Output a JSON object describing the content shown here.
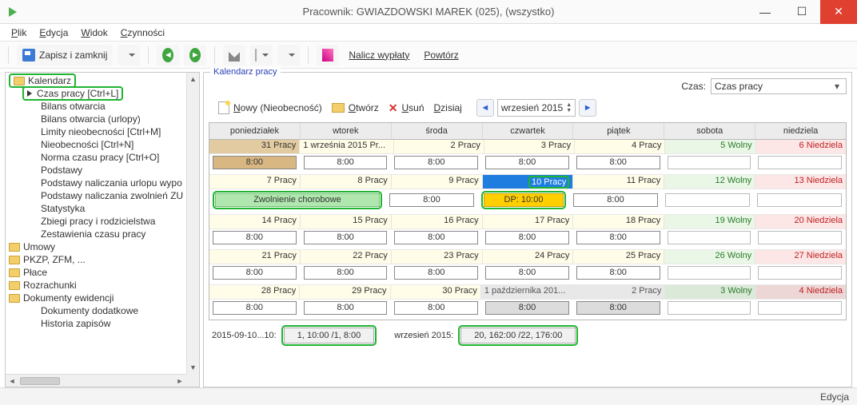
{
  "window": {
    "title": "Pracownik: GWIAZDOWSKI MAREK (025), (wszystko)"
  },
  "menubar": {
    "plik": "Plik",
    "edycja": "Edycja",
    "widok": "Widok",
    "czynnosci": "Czynności"
  },
  "toolbar": {
    "save_close": "Zapisz i zamknij",
    "nalicz": "Nalicz wypłaty",
    "powtorz": "Powtórz"
  },
  "tree": {
    "kalendarz": "Kalendarz",
    "czas_pracy": "Czas pracy [Ctrl+L]",
    "bilans_otwarcia": "Bilans otwarcia",
    "bilans_otwarcia_urlopy": "Bilans otwarcia (urlopy)",
    "limity": "Limity nieobecności [Ctrl+M]",
    "nieobecnosci": "Nieobecności [Ctrl+N]",
    "norma": "Norma czasu pracy [Ctrl+O]",
    "podstawy": "Podstawy",
    "podst_urlop": "Podstawy naliczania urlopu wypo",
    "podst_zwol": "Podstawy naliczania zwolnień ZU",
    "statystyka": "Statystyka",
    "zbiegi": "Zbiegi pracy i rodzicielstwa",
    "zestawienia": "Zestawienia czasu pracy",
    "umowy": "Umowy",
    "pkzp": "PKZP, ZFM, ...",
    "place": "Płace",
    "rozrachunki": "Rozrachunki",
    "dok_ewid": "Dokumenty ewidencji",
    "dok_dodat": "Dokumenty dodatkowe",
    "historia": "Historia zapisów"
  },
  "panel": {
    "fieldset_title": "Kalendarz pracy",
    "czas_label": "Czas:",
    "czas_value": "Czas pracy",
    "tb_nowy": "Nowy (Nieobecność)",
    "tb_otworz": "Otwórz",
    "tb_usun": "Usuń",
    "tb_dzisiaj": "Dzisiaj",
    "month": "wrzesień 2015"
  },
  "cal": {
    "days": [
      "poniedziałek",
      "wtorek",
      "środa",
      "czwartek",
      "piątek",
      "sobota",
      "niedziela"
    ],
    "w1": {
      "d": [
        "31 Pracy",
        "1 września 2015 Pr...",
        "2 Pracy",
        "3 Pracy",
        "4 Pracy",
        "5 Wolny",
        "6 Niedziela"
      ],
      "e": [
        "8:00",
        "8:00",
        "8:00",
        "8:00",
        "8:00",
        "",
        ""
      ]
    },
    "w2": {
      "d": [
        "7 Pracy",
        "8 Pracy",
        "9 Pracy",
        "10 Pracy",
        "11 Pracy",
        "12 Wolny",
        "13 Niedziela"
      ],
      "e_sick": "Zwolnienie chorobowe",
      "e3": "8:00",
      "e4": "DP: 10:00",
      "e5": "8:00"
    },
    "w3": {
      "d": [
        "14 Pracy",
        "15 Pracy",
        "16 Pracy",
        "17 Pracy",
        "18 Pracy",
        "19 Wolny",
        "20 Niedziela"
      ],
      "e": [
        "8:00",
        "8:00",
        "8:00",
        "8:00",
        "8:00",
        "",
        ""
      ]
    },
    "w4": {
      "d": [
        "21 Pracy",
        "22 Pracy",
        "23 Pracy",
        "24 Pracy",
        "25 Pracy",
        "26 Wolny",
        "27 Niedziela"
      ],
      "e": [
        "8:00",
        "8:00",
        "8:00",
        "8:00",
        "8:00",
        "",
        ""
      ]
    },
    "w5": {
      "d": [
        "28 Pracy",
        "29 Pracy",
        "30 Pracy",
        "1 października 201...",
        "2 Pracy",
        "3 Wolny",
        "4 Niedziela"
      ],
      "e": [
        "8:00",
        "8:00",
        "8:00",
        "8:00",
        "8:00",
        "",
        ""
      ]
    }
  },
  "summary": {
    "left_label": "2015-09-10...10:",
    "left_value": "1, 10:00 /1, 8:00",
    "right_label": "wrzesień 2015:",
    "right_value": "20, 162:00 /22, 176:00"
  },
  "status": {
    "mode": "Edycja"
  }
}
